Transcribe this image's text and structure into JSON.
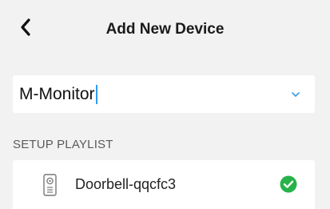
{
  "header": {
    "title": "Add New Device",
    "back_icon": "chevron-left-icon"
  },
  "device_select": {
    "value": "M-Monitor",
    "icon": "chevron-down-icon",
    "accent_color": "#2f9bf0"
  },
  "setup_playlist": {
    "label": "SETUP PLAYLIST",
    "items": [
      {
        "label": "Doorbell-qqcfc3",
        "icon": "doorbell-icon",
        "status_icon": "check-circle-icon",
        "status_color": "#27b24a"
      }
    ]
  }
}
